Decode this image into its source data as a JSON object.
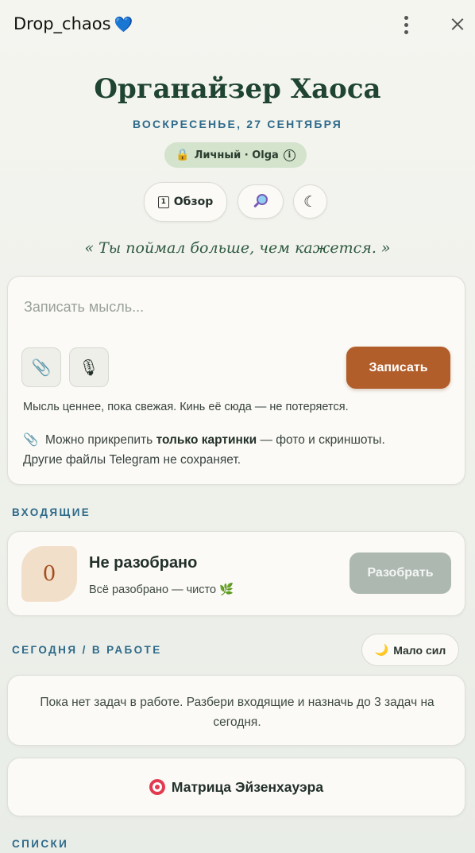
{
  "window": {
    "title": "Drop_chaos",
    "title_emoji": "💙"
  },
  "header": {
    "app_title": "Органайзер Хаоса",
    "date": "ВОСКРЕСЕНЬЕ, 27 СЕНТЯБРЯ",
    "badge": {
      "lock": "🔒",
      "text": "Личный · Olga",
      "info": "i"
    },
    "overview": {
      "calendar_digit": "1",
      "label": "Обзор"
    },
    "moon": "☾",
    "quote": "« Ты поймал больше, чем кажется. »"
  },
  "capture": {
    "placeholder": "Записать мысль...",
    "value": "",
    "clip_icon": "📎",
    "mic_icon": "🎙",
    "submit_label": "Записать",
    "hint": "Мысль ценнее, пока свежая. Кинь её сюда — не потеряется.",
    "attach_note": {
      "icon": "📎",
      "before": "Можно прикрепить ",
      "bold": "только картинки",
      "after": " — фото и скриншоты.",
      "line2": "Другие файлы Telegram не сохраняет."
    }
  },
  "inbox": {
    "section_label": "ВХОДЯЩИЕ",
    "count": "0",
    "title": "Не разобрано",
    "subtitle": "Всё разобрано — чисто",
    "subtitle_emoji": "🌿",
    "sort_button": "Разобрать"
  },
  "today": {
    "section_label": "СЕГОДНЯ / В РАБОТЕ",
    "low_energy": {
      "icon": "🌙",
      "label": "Мало сил"
    },
    "empty_text": "Пока нет задач в работе. Разбери входящие и назначь до 3 задач на сегодня."
  },
  "matrix": {
    "label": "Матрица Эйзенхауэра"
  },
  "lists": {
    "section_label": "СПИСКИ"
  },
  "colors": {
    "accent_blue": "#2e6a8a",
    "title_green": "#1f4432",
    "primary_button": "#b25e2b",
    "badge_bg": "#d3e3cc",
    "disabled_button": "#adb8b0"
  }
}
